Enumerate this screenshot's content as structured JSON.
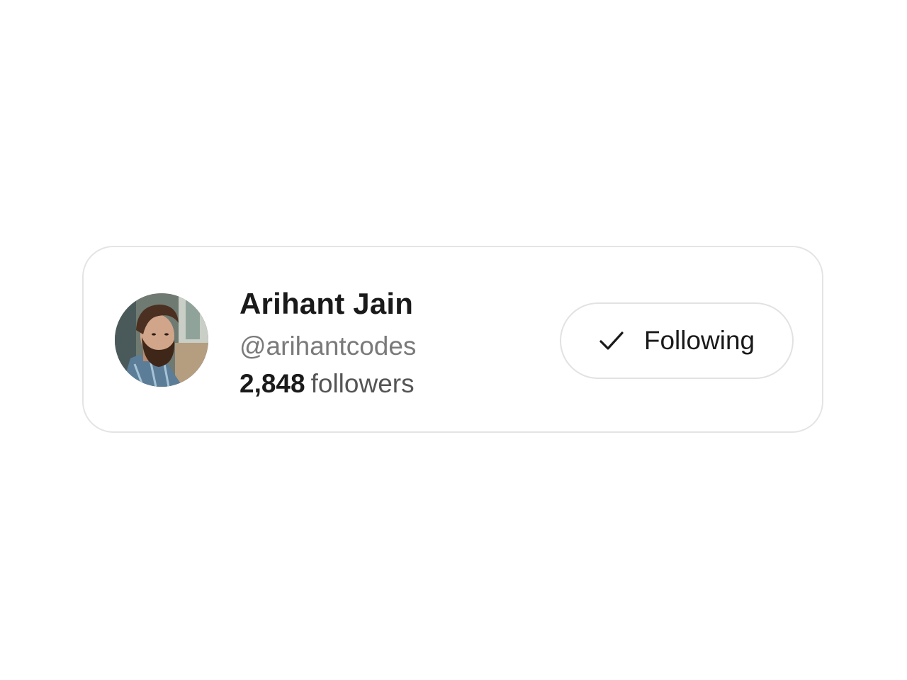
{
  "profile": {
    "name": "Arihant Jain",
    "handle": "@arihantcodes",
    "followers_count": "2,848",
    "followers_label": "followers",
    "avatar_icon": "user-avatar-photo"
  },
  "follow_button": {
    "label": "Following",
    "icon": "check-icon",
    "state": "following"
  },
  "colors": {
    "text_primary": "#1a1a1a",
    "text_secondary": "#7a7a7a",
    "border": "#e4e4e4",
    "background": "#ffffff"
  }
}
